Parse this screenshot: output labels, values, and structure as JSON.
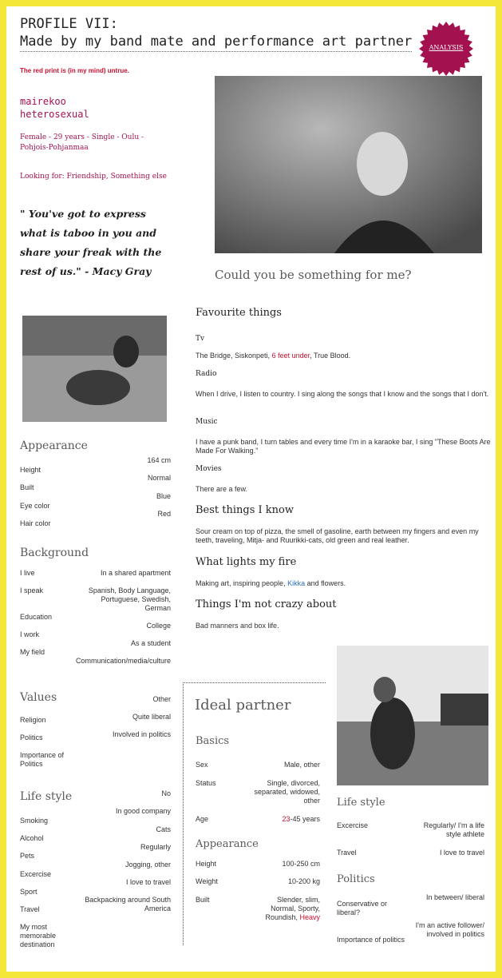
{
  "header": {
    "title_line1": "PROFILE VII:",
    "title_line2": "Made by my band mate and performance art partner",
    "badge": "ANALYSIS",
    "notice": "The red print is (in my mind) untrue."
  },
  "profile": {
    "username": "mairekoo",
    "orientation": "heterosexual",
    "details": "Female - 29 years - Single - Oulu - Pohjois-Pohjanmaa",
    "looking_for": "Looking for: Friendship, Something else",
    "quote": "\" You've got to express what is taboo in you and share your freak with the rest of us.\" - Macy Gray",
    "tagline": "Could you be something for me?"
  },
  "appearance": {
    "title": "Appearance",
    "labels": [
      "Height",
      "Built",
      "Eye color",
      "Hair color"
    ],
    "values": [
      "164 cm",
      "Normal",
      "Blue",
      "Red"
    ]
  },
  "background": {
    "title": "Background",
    "labels": [
      "I live",
      "I speak",
      "Education",
      "I work",
      "My field"
    ],
    "values": [
      "In a shared apartment",
      "Spanish, Body Language, Portuguese, Swedish, German",
      "College",
      "As a student",
      "Communication/media/culture"
    ]
  },
  "values_sec": {
    "title": "Values",
    "labels": [
      "Religion",
      "Politics",
      "Importance of Politics"
    ],
    "values": [
      "Other",
      "Quite liberal",
      "Involved in politics"
    ]
  },
  "lifestyle": {
    "title": "Life style",
    "labels": [
      "Smoking",
      "Alcohol",
      "Pets",
      "Excercise",
      "Sport",
      "Travel",
      "My most memorable destination"
    ],
    "values": [
      "No",
      "In good company",
      "Cats",
      "Regularly",
      "Jogging, other",
      "I love to travel",
      "Backpacking around South America"
    ]
  },
  "favourites": {
    "title": "Favourite things",
    "tv_label": "Tv",
    "tv_a": "The Bridge, Siskonpeti, ",
    "tv_b": "6 feet under",
    "tv_c": ", True Blood.",
    "radio_label": "Radio",
    "radio": "When I drive, I listen to country. I sing along the songs that I know and the songs that I don't.",
    "music_label": "Music",
    "music": "I have a punk band, I turn tables and every time I'm in a karaoke bar, I sing \"These Boots Are Made For Walking.\"",
    "movies_label": "Movies",
    "movies": "There are a few."
  },
  "best": {
    "title": "Best things I know",
    "text": "Sour cream on top of pizza, the smell of gasoline, earth between my fingers and even my teeth, traveling, Mitja- and Ruurikki-cats, old green and real leather."
  },
  "fire": {
    "title": "What lights my fire",
    "text_a": "Making art, inspiring people, ",
    "text_b": "Kikka",
    "text_c": " and flowers."
  },
  "notcrazy": {
    "title": "Things I'm not crazy about",
    "text": "Bad manners and box life."
  },
  "ideal": {
    "title": "Ideal partner",
    "basics_title": "Basics",
    "basics_labels": [
      "Sex",
      "Status",
      "Age"
    ],
    "basics_values": [
      "Male, other",
      "Single, divorced, separated, widowed, other"
    ],
    "age_a": "23",
    "age_b": "-45 years",
    "appearance_title": "Appearance",
    "app_labels": [
      "Height",
      "Weight",
      "Built"
    ],
    "height": "100-250 cm",
    "weight": "10-200 kg",
    "built_a": "Slender, slim, Normal, Sporty, Roundish, ",
    "built_b": "Heavy",
    "lifestyle_title": "Life style",
    "ls_labels": [
      "Excercise",
      "Travel"
    ],
    "ls_values": [
      "Regularly/ I'm a life style athlete",
      "I love to travel"
    ],
    "politics_title": "Politics",
    "pol_labels": [
      "Conservative or liberal?",
      "Importance of politics"
    ],
    "pol_values": [
      "In between/ liberal",
      "I'm an active follower/ involved in politics"
    ]
  },
  "colors": {
    "accent": "#a3124f",
    "notice": "#c8102e",
    "frame": "#f5e73a"
  }
}
